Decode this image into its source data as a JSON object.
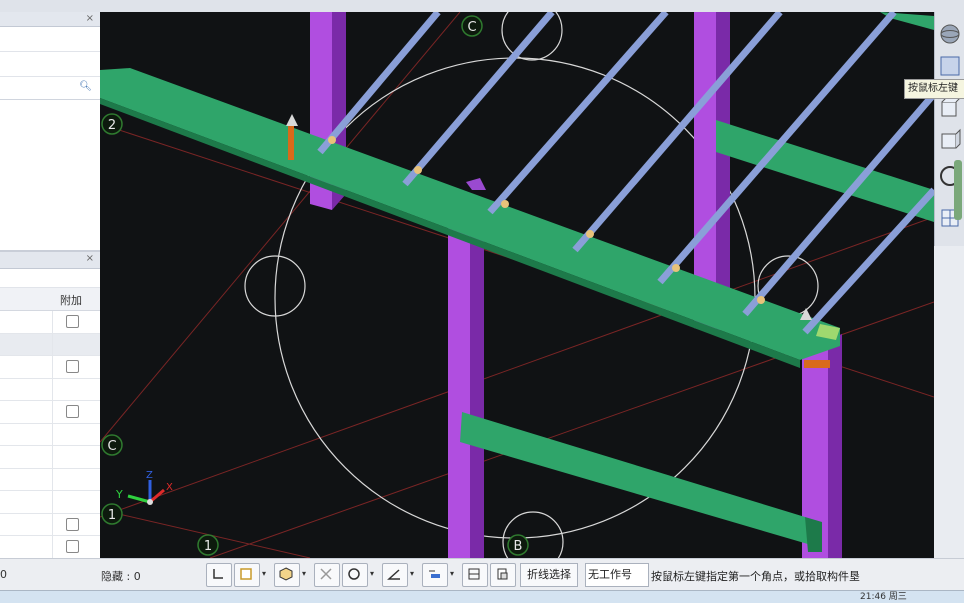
{
  "left_panel": {
    "column_header": "附加",
    "rows": [
      {
        "checkbox": true
      },
      {
        "checkbox": false,
        "selected": true
      },
      {
        "checkbox": true
      },
      {
        "checkbox": false
      },
      {
        "checkbox": true
      },
      {
        "checkbox": false
      },
      {
        "checkbox": false
      },
      {
        "checkbox": false
      },
      {
        "checkbox": false
      },
      {
        "checkbox": true
      },
      {
        "checkbox": true
      }
    ]
  },
  "viewport": {
    "grid_labels": {
      "c_top": "C",
      "two_left": "2",
      "c_left": "C",
      "one_left_a": "1",
      "one_left_b": "1",
      "b_bottom": "B",
      "two_right": "2"
    },
    "axis_labels": {
      "x": "X",
      "y": "Y",
      "z": "Z"
    },
    "colors": {
      "background": "#101214",
      "beam_green": "#2fa56a",
      "column_purple": "#b04ee0",
      "purlin_blue": "#8a9fd8",
      "grid_line": "#8a2a2a",
      "circle": "#d8d8d8"
    }
  },
  "right_toolbar": {
    "tooltip": "按鼠标左键",
    "icons": [
      "sphere-view-icon",
      "view-cube-icon",
      "box-view-icon",
      "orbit-icon",
      "section-icon"
    ]
  },
  "statusbar": {
    "left_value": "0",
    "hidden_label": "隐藏 : 0",
    "polyline_button": "折线选择",
    "workset_value": "无工作号",
    "prompt": "按鼠标左键指定第一个角点，或拾取构件垦"
  },
  "taskbar": {
    "clock": "21:46 周三"
  }
}
